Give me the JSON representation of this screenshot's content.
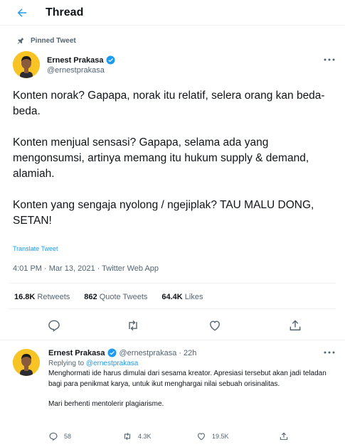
{
  "header": {
    "title": "Thread",
    "back_icon": "arrow-left-icon",
    "accent": "#1d9bf0"
  },
  "pinned": {
    "label": "Pinned Tweet",
    "icon": "pin-icon"
  },
  "tweet": {
    "author": {
      "name": "Ernest Prakasa",
      "handle": "@ernestprakasa",
      "verified": true
    },
    "paragraphs": [
      "Konten norak? Gapapa, norak itu relatif, selera orang kan beda-beda.",
      "Konten menjual sensasi? Gapapa, selama ada yang mengonsumsi, artinya memang itu hukum supply & demand, alamiah.",
      "Konten yang sengaja nyolong / ngejiplak? TAU MALU DONG, SETAN!"
    ],
    "translate_label": "Translate Tweet",
    "meta": "4:01 PM · Mar 13, 2021 · Twitter Web App",
    "stats": {
      "retweets_count": "16.8K",
      "retweets_label": "Retweets",
      "quotes_count": "862",
      "quotes_label": "Quote Tweets",
      "likes_count": "64.4K",
      "likes_label": "Likes"
    },
    "actions": [
      "reply-icon",
      "retweet-icon",
      "like-icon",
      "share-icon"
    ]
  },
  "reply": {
    "author": {
      "name": "Ernest Prakasa",
      "handle": "@ernestprakasa",
      "verified": true
    },
    "dot": "·",
    "time": "22h",
    "replying_prefix": "Replying to",
    "replying_handle": "@ernestprakasa",
    "paragraphs": [
      "Menghormati ide harus dimulai dari sesama kreator. Apresiasi tersebut akan jadi teladan bagi para penikmat karya, untuk ikut menghargai nilai sebuah orisinalitas.",
      "Mari berhenti mentolerir plagiarisme."
    ],
    "counts": {
      "replies": "58",
      "retweets": "4.3K",
      "likes": "19.5K"
    }
  },
  "colors": {
    "text": "#0f1419",
    "secondary": "#536471",
    "accent": "#1d9bf0",
    "divider": "#eff3f4",
    "avatar_bg": "#f7c325"
  }
}
